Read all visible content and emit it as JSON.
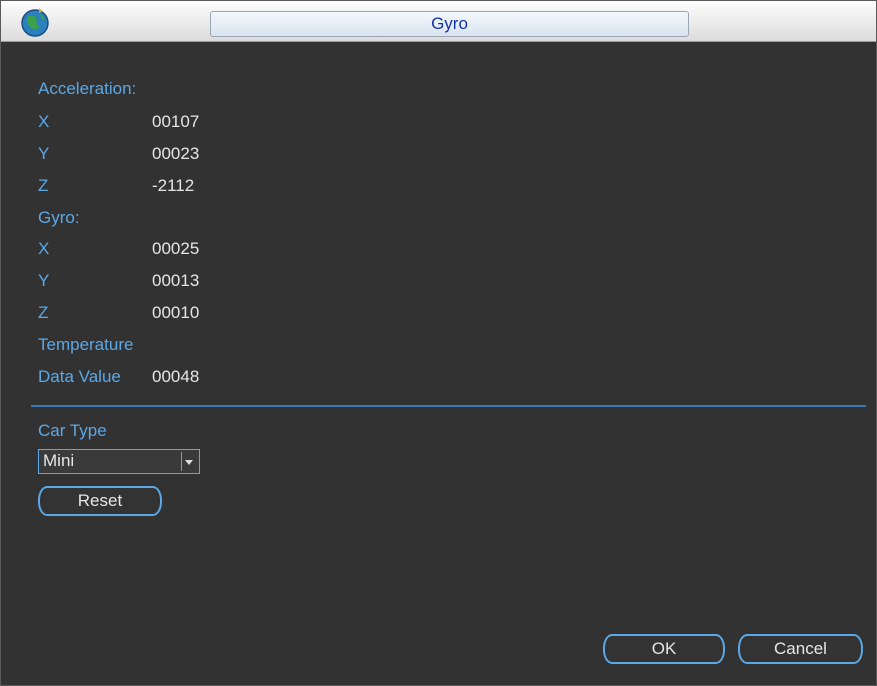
{
  "window": {
    "title": "Gyro",
    "icon": "globe-icon"
  },
  "acceleration": {
    "header": "Acceleration:",
    "rows": [
      {
        "axis": "X",
        "value": "00107"
      },
      {
        "axis": "Y",
        "value": "00023"
      },
      {
        "axis": "Z",
        "value": "-2112"
      }
    ]
  },
  "gyro": {
    "header": "Gyro:",
    "rows": [
      {
        "axis": "X",
        "value": "00025"
      },
      {
        "axis": "Y",
        "value": "00013"
      },
      {
        "axis": "Z",
        "value": "00010"
      }
    ]
  },
  "temperature": {
    "header": "Temperature",
    "data_label": "Data Value",
    "data_value": "00048"
  },
  "car_type": {
    "label": "Car Type",
    "selected": "Mini"
  },
  "buttons": {
    "reset": "Reset",
    "ok": "OK",
    "cancel": "Cancel"
  },
  "colors": {
    "label": "#5ba8e6",
    "value": "#e6e6e6",
    "title": "#1233a8",
    "background": "#313131"
  }
}
